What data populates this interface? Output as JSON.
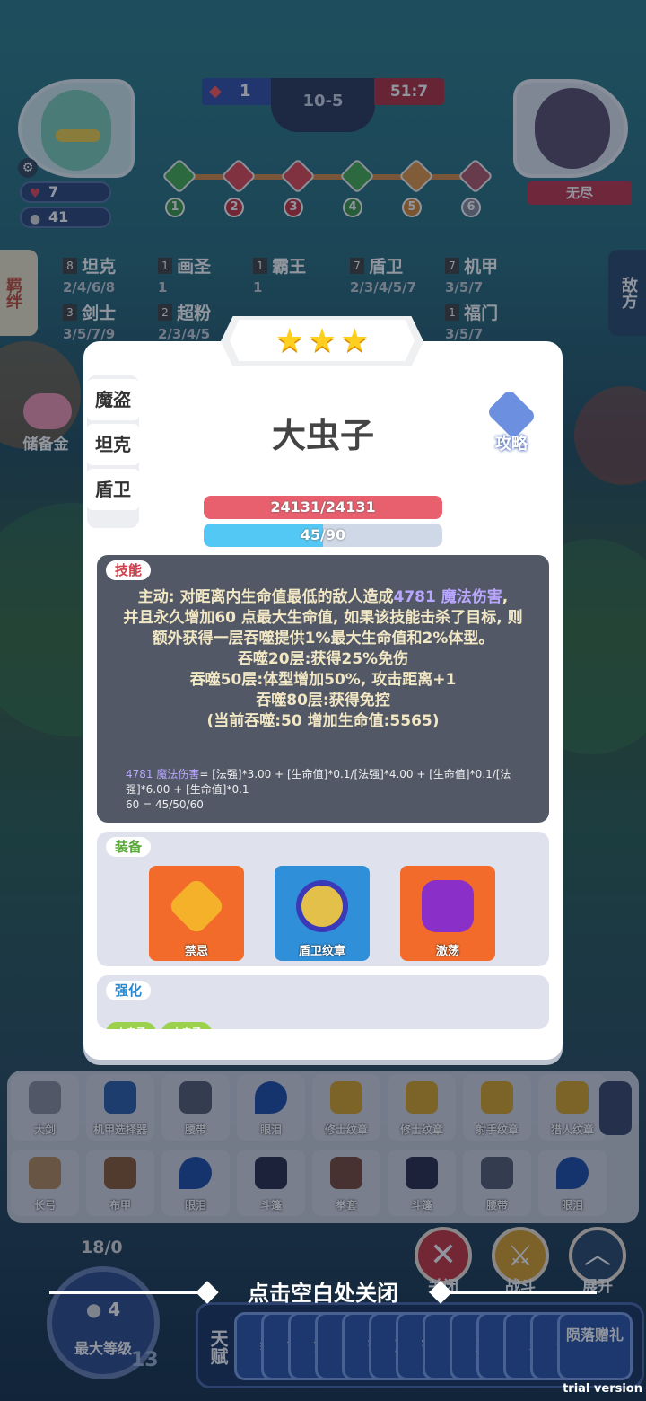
{
  "hud": {
    "hp": "7",
    "gold": "41",
    "score_left": "1",
    "round": "10-5",
    "score_right": "51:7",
    "round_markers": [
      "1",
      "2",
      "3",
      "4",
      "5",
      "6"
    ],
    "enemy_name": "无尽"
  },
  "synergy": {
    "left_tab": "羁绊",
    "right_tab": "敌方",
    "rows": [
      {
        "count": "8",
        "name": "坦克",
        "levels": "2/4/6/8"
      },
      {
        "count": "1",
        "name": "画圣",
        "levels": "1"
      },
      {
        "count": "1",
        "name": "霸王",
        "levels": "1"
      },
      {
        "count": "7",
        "name": "盾卫",
        "levels": "2/3/4/5/7"
      },
      {
        "count": "7",
        "name": "机甲",
        "levels": "3/5/7"
      },
      {
        "count": "3",
        "name": "剑士",
        "levels": "3/5/7/9"
      },
      {
        "count": "2",
        "name": "超粉",
        "levels": "2/3/4/5"
      },
      {
        "count": "1",
        "name": "福门",
        "levels": "3/5/7"
      }
    ]
  },
  "piggy_label": "储备金",
  "modal": {
    "stars": 3,
    "class_tabs": [
      "魔盗",
      "坦克",
      "盾卫"
    ],
    "unit_name": "大虫子",
    "guide_label": "攻略",
    "hp_text": "24131/24131",
    "hp_ratio": 1.0,
    "mana_text": "45/90",
    "mana_ratio": 0.5,
    "skill": {
      "label": "技能",
      "line1_prefix": "主动: 对距离内生命值最低的敌人造成",
      "line1_value": "4781 魔法伤害",
      "line1_suffix": ",",
      "line2": "并且永久增加60 点最大生命值, 如果该技能击杀了目标, 则额外获得一层吞噬提供1%最大生命值和2%体型。",
      "line3": "吞噬20层:获得25%免伤",
      "line4": "吞噬50层:体型增加50%, 攻击距离+1",
      "line5": "吞噬80层:获得免控",
      "line6": "(当前吞噬:50 增加生命值:5565)",
      "formula_value": "4781 魔法伤害",
      "formula_rest": "= [法强]*3.00 + [生命值]*0.1/[法强]*4.00 + [生命值]*0.1/[法强]*6.00 + [生命值]*0.1",
      "formula_line2": "60 = 45/50/60"
    },
    "equipment": {
      "label": "装备",
      "items": [
        {
          "name": "禁忌",
          "color": "#f26b2a"
        },
        {
          "name": "盾卫纹章",
          "color": "#2f8fd8"
        },
        {
          "name": "激荡",
          "color": "#f26b2a"
        }
      ]
    },
    "enhance": {
      "label": "强化",
      "chips": [
        "大虫子",
        "大虫子"
      ]
    }
  },
  "close_hint": "点击空白处关闭",
  "inventory": {
    "row1": [
      "大剑",
      "机甲选择器",
      "腰带",
      "眼泪",
      "修士纹章",
      "修士纹章",
      "射手纹章",
      "猎人纹章"
    ],
    "row2": [
      "长弓",
      "布甲",
      "眼泪",
      "斗篷",
      "拳套",
      "斗篷",
      "腰带",
      "眼泪"
    ]
  },
  "bottom": {
    "xp": "18/0",
    "level_gold": "4",
    "level_label": "最大等级",
    "level": "13",
    "buttons": [
      "关闭",
      "战斗",
      "展开"
    ],
    "talent_head": "天赋",
    "talents": [
      "装",
      "领",
      "金",
      "[",
      "钥",
      "重",
      "锅",
      "吸",
      "对",
      "[",
      "水",
      "击",
      "陨落赠礼"
    ]
  },
  "watermark": "trial version"
}
